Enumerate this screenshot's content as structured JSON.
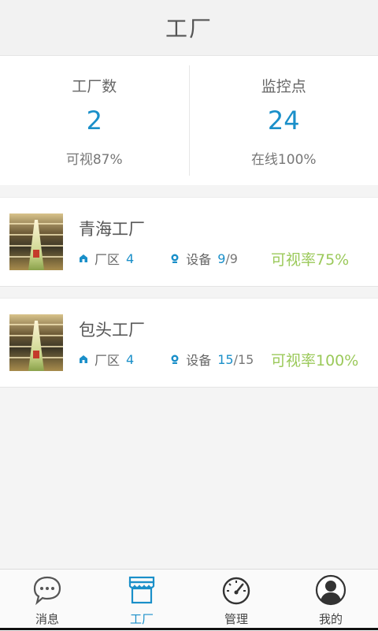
{
  "header": {
    "title": "工厂"
  },
  "stats": [
    {
      "label": "工厂数",
      "value": "2",
      "sub": "可视87%"
    },
    {
      "label": "监控点",
      "value": "24",
      "sub": "在线100%"
    }
  ],
  "factories": [
    {
      "name": "青海工厂",
      "zone_label": "厂区",
      "zone_count": "4",
      "device_label": "设备",
      "device_online": "9",
      "device_sep": "/",
      "device_total": "9",
      "rate": "可视率75%"
    },
    {
      "name": "包头工厂",
      "zone_label": "厂区",
      "zone_count": "4",
      "device_label": "设备",
      "device_online": "15",
      "device_sep": "/",
      "device_total": "15",
      "rate": "可视率100%"
    }
  ],
  "tabs": [
    {
      "label": "消息",
      "icon": "chat-bubble-icon"
    },
    {
      "label": "工厂",
      "icon": "store-icon",
      "active": true
    },
    {
      "label": "管理",
      "icon": "speedometer-icon"
    },
    {
      "label": "我的",
      "icon": "user-avatar-icon"
    }
  ],
  "colors": {
    "accent": "#1a8fc9",
    "rate_green": "#9bc95a"
  }
}
